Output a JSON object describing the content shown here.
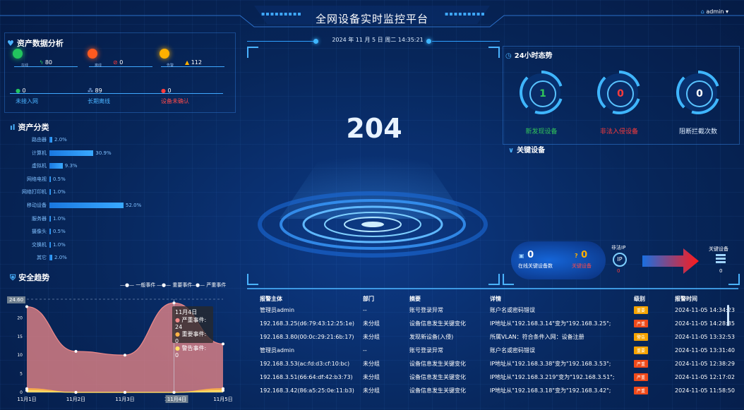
{
  "header": {
    "title": "全网设备实时监控平台",
    "user": "admin",
    "datetime": "2024 年 11 月 5 日 周二 14:35:21"
  },
  "asset_analysis": {
    "title": "资产数据分析",
    "top_stats": [
      {
        "caption": "在线",
        "value": "80",
        "color": "#22c55e"
      },
      {
        "caption": "离线",
        "value": "0",
        "color": "#ff5a1f"
      },
      {
        "caption": "告警",
        "value": "112",
        "color": "#ffb000"
      }
    ],
    "sub_stats": [
      {
        "value": "0",
        "label": "未接入网"
      },
      {
        "value": "89",
        "label": "长期离线"
      },
      {
        "value": "0",
        "label": "设备未确认"
      }
    ]
  },
  "asset_category": {
    "title": "资产分类",
    "items": [
      {
        "label": "路由器",
        "value": "2.0%",
        "pct": 2.0
      },
      {
        "label": "计算机",
        "value": "30.9%",
        "pct": 30.9
      },
      {
        "label": "虚拟机",
        "value": "9.3%",
        "pct": 9.3
      },
      {
        "label": "网络电视",
        "value": "0.5%",
        "pct": 0.5
      },
      {
        "label": "网络打印机",
        "value": "1.0%",
        "pct": 1.0
      },
      {
        "label": "移动设备",
        "value": "52.0%",
        "pct": 52.0
      },
      {
        "label": "服务器",
        "value": "1.0%",
        "pct": 1.0
      },
      {
        "label": "摄像头",
        "value": "0.5%",
        "pct": 0.5
      },
      {
        "label": "交换机",
        "value": "1.0%",
        "pct": 1.0
      },
      {
        "label": "其它",
        "value": "2.0%",
        "pct": 2.0
      }
    ]
  },
  "security_trend": {
    "title": "安全趋势",
    "legend": [
      "一般事件",
      "重要事件",
      "严重事件"
    ],
    "tooltip": {
      "title": "11月4日",
      "lines": [
        "严重事件: 24",
        "重要事件: 0",
        "警告事件: 0"
      ]
    },
    "max_marker": "24.60",
    "hover_label": "11月4日"
  },
  "chart_data": {
    "type": "area",
    "categories": [
      "11月1日",
      "11月2日",
      "11月3日",
      "11月4日",
      "11月5日"
    ],
    "ylim": [
      0,
      25
    ],
    "yticks": [
      "0",
      "5",
      "10",
      "15",
      "20"
    ],
    "series": [
      {
        "name": "严重事件",
        "values": [
          23,
          11,
          10,
          24,
          13
        ],
        "color": "#f08a8a"
      },
      {
        "name": "重要事件",
        "values": [
          1,
          0,
          0,
          0,
          1
        ],
        "color": "#ffb347"
      },
      {
        "name": "一般事件",
        "values": [
          0.5,
          0,
          0,
          0,
          0.5
        ],
        "color": "#ffe066"
      }
    ]
  },
  "center": {
    "count": "204"
  },
  "trend24": {
    "title": "24小时态势",
    "rings": [
      {
        "value": "1",
        "label": "新发现设备",
        "color": "#31c45a"
      },
      {
        "value": "0",
        "label": "非法入侵设备",
        "color": "#ff3b3b"
      },
      {
        "value": "0",
        "label": "阻断拦截次数",
        "color": "#ffffff"
      }
    ]
  },
  "key_devices": {
    "title": "关键设备",
    "online_value": "0",
    "online_label": "在线关键设备数",
    "offline_value": "0",
    "offline_label": "关键设备",
    "illegal_ip_label": "非法IP",
    "illegal_ip_count": "0",
    "key_device_label": "关键设备",
    "key_device_count": "0"
  },
  "table": {
    "headers": [
      "报警主体",
      "部门",
      "摘要",
      "详情",
      "级别",
      "报警时间"
    ],
    "rows": [
      {
        "subject": "管理员admin",
        "dept": "--",
        "summary": "账号登录异常",
        "detail": "账户名或密码错误",
        "level": "重要",
        "level_color": "#f5a300",
        "time": "2024-11-05 14:34:23"
      },
      {
        "subject": "192.168.3.25(d6:79:43:12:25:1e)",
        "dept": "未分组",
        "summary": "设备信息发生关键变化",
        "detail": "IP地址从\"192.168.3.14\"变为\"192.168.3.25\";",
        "level": "严重",
        "level_color": "#f04a1a",
        "time": "2024-11-05 14:28:35"
      },
      {
        "subject": "192.168.3.80(00:0c:29:21:6b:17)",
        "dept": "未分组",
        "summary": "发现新设备(入侵)",
        "detail": "所属VLAN：符合条件入网：设备注册",
        "level": "警告",
        "level_color": "#f5a300",
        "time": "2024-11-05 13:32:53"
      },
      {
        "subject": "管理员admin",
        "dept": "--",
        "summary": "账号登录异常",
        "detail": "账户名或密码错误",
        "level": "重要",
        "level_color": "#f5a300",
        "time": "2024-11-05 13:31:40"
      },
      {
        "subject": "192.168.3.53(ac:fd:d3:cf:10:bc)",
        "dept": "未分组",
        "summary": "设备信息发生关键变化",
        "detail": "IP地址从\"192.168.3.38\"变为\"192.168.3.53\";",
        "level": "严重",
        "level_color": "#f04a1a",
        "time": "2024-11-05 12:38:29"
      },
      {
        "subject": "192.168.3.51(66:64:df:42:b3:73)",
        "dept": "未分组",
        "summary": "设备信息发生关键变化",
        "detail": "IP地址从\"192.168.3.219\"变为\"192.168.3.51\";",
        "level": "严重",
        "level_color": "#f04a1a",
        "time": "2024-11-05 12:17:02"
      },
      {
        "subject": "192.168.3.42(86:a5:25:0e:11:b3)",
        "dept": "未分组",
        "summary": "设备信息发生关键变化",
        "detail": "IP地址从\"192.168.3.18\"变为\"192.168.3.42\";",
        "level": "严重",
        "level_color": "#f04a1a",
        "time": "2024-11-05 11:58:50"
      }
    ]
  }
}
